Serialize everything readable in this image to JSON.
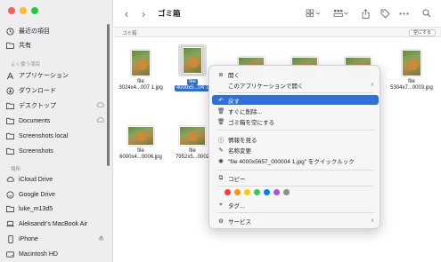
{
  "window": {
    "title": "ゴミ箱"
  },
  "colors": {
    "close": "#ff5f57",
    "minimize": "#febc2e",
    "zoom": "#28c840",
    "selection": "#2e6fd9"
  },
  "sidebar": {
    "top_items": [
      {
        "label": "最近の項目",
        "icon": "clock-icon"
      },
      {
        "label": "共有",
        "icon": "shared-folder-icon"
      }
    ],
    "favorites_header": "よく使う項目",
    "favorites": [
      {
        "label": "アプリケーション",
        "icon": "apps-icon"
      },
      {
        "label": "ダウンロード",
        "icon": "download-icon"
      },
      {
        "label": "デスクトップ",
        "icon": "folder-icon",
        "trail": "cloud-icon"
      },
      {
        "label": "Documents",
        "icon": "folder-icon",
        "trail": "cloud-icon"
      },
      {
        "label": "Screenshots local",
        "icon": "folder-icon"
      },
      {
        "label": "Screenshots",
        "icon": "folder-icon"
      }
    ],
    "locations_header": "場所",
    "locations": [
      {
        "label": "iCloud Drive",
        "icon": "cloud-icon"
      },
      {
        "label": "Google Drive",
        "icon": "drive-icon"
      },
      {
        "label": "luke_m13d5",
        "icon": "folder-icon"
      },
      {
        "label": "Aleksandr's MacBook Air",
        "icon": "laptop-icon"
      },
      {
        "label": "iPhone",
        "icon": "phone-icon",
        "trail": "eject-icon"
      },
      {
        "label": "Macintosh HD",
        "icon": "disk-icon"
      }
    ]
  },
  "toolbar": {
    "back": "‹",
    "forward": "›",
    "view_icon": "grid-view-icon",
    "group_icon": "group-icon",
    "share_icon": "share-icon",
    "tag_icon": "tag-icon",
    "more_icon": "more-icon",
    "search_icon": "search-icon"
  },
  "pathbar": {
    "crumb": "ゴミ箱",
    "empty_button": "空にする"
  },
  "files": [
    {
      "line1": "file",
      "line2": "3024x4...007 1.jpg",
      "orientation": "portrait"
    },
    {
      "line1": "file",
      "line2": "4000x5...04 1",
      "orientation": "portrait",
      "selected": true
    },
    {
      "line1": "",
      "line2": "",
      "orientation": "wide"
    },
    {
      "line1": "",
      "line2": "",
      "orientation": "wide"
    },
    {
      "line1": "",
      "line2": "",
      "orientation": "wide"
    },
    {
      "line1": "file",
      "line2": "5304x7...0003.jpg",
      "orientation": "portrait"
    },
    {
      "line1": "file",
      "line2": "6000x4...0006.jpg",
      "orientation": "wide"
    },
    {
      "line1": "file",
      "line2": "7952x5...0002",
      "orientation": "wide"
    }
  ],
  "menu": {
    "items": [
      {
        "label": "開く",
        "icon": "open-icon"
      },
      {
        "label": "このアプリケーションで開く",
        "icon": "",
        "submenu": true
      },
      {
        "label": "戻す",
        "icon": "undo-icon",
        "highlighted": true
      },
      {
        "label": "すぐに削除...",
        "icon": "trash-icon"
      },
      {
        "label": "ゴミ箱を空にする",
        "icon": "trash-icon"
      },
      {
        "label": "情報を見る",
        "icon": "info-icon"
      },
      {
        "label": "名称変更",
        "icon": "pencil-icon"
      },
      {
        "label": "\"file 4000x5657_000004 1.jpg\" をクイックルック",
        "icon": "eye-icon"
      },
      {
        "label": "コピー",
        "icon": "copy-icon"
      },
      {
        "label": "タグ...",
        "icon": "tag-icon"
      },
      {
        "label": "サービス",
        "icon": "gear-icon",
        "submenu": true
      }
    ],
    "tag_colors": [
      "#ff3b30",
      "#ff9500",
      "#ffcc00",
      "#34c759",
      "#007aff",
      "#af52de",
      "#8e8e93"
    ]
  }
}
